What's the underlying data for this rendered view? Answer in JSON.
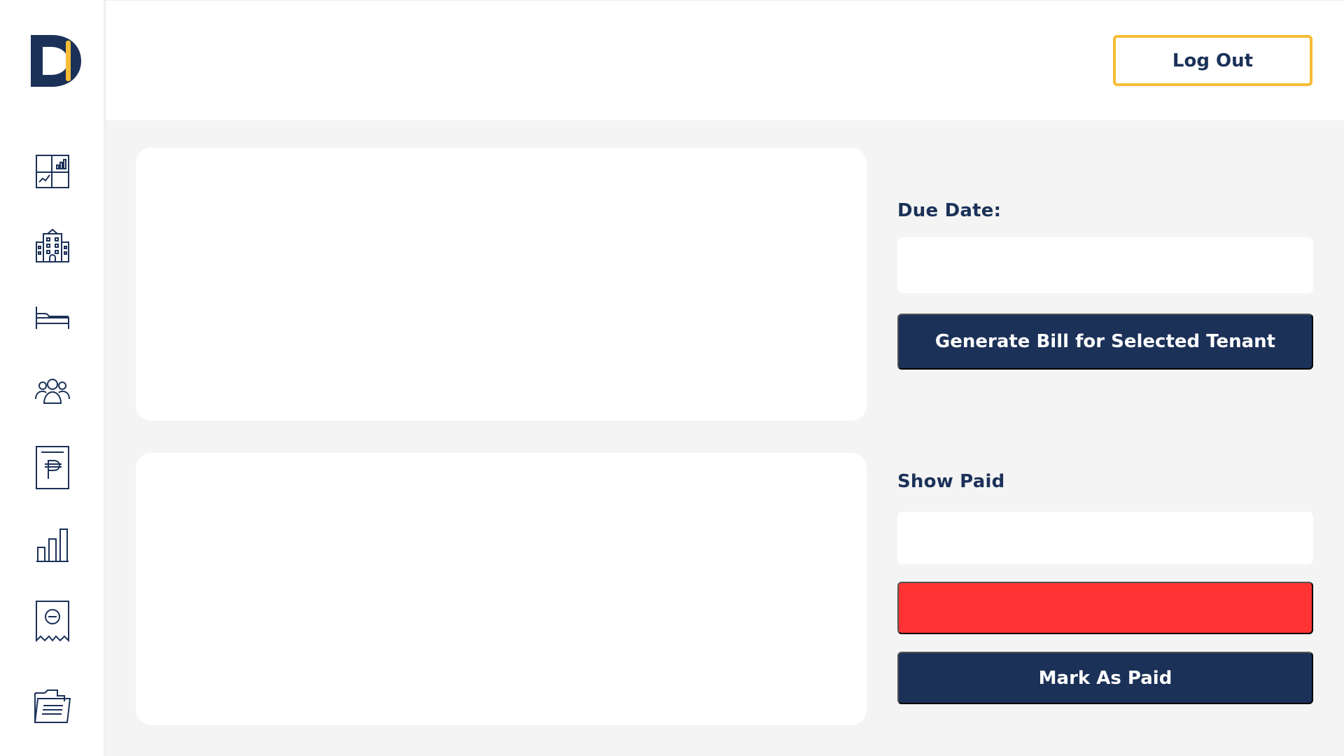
{
  "colors": {
    "navy": "#1b3158",
    "accent_yellow": "#f6bd35",
    "danger_red": "#ff3333",
    "background": "#f4f4f4"
  },
  "sidebar": {
    "logo_icon": "brand-logo-d",
    "items": [
      {
        "id": "dashboard",
        "icon": "dashboard-icon"
      },
      {
        "id": "buildings",
        "icon": "building-icon"
      },
      {
        "id": "rooms",
        "icon": "bed-icon"
      },
      {
        "id": "tenants",
        "icon": "users-icon"
      },
      {
        "id": "billing",
        "icon": "peso-bill-icon"
      },
      {
        "id": "reports",
        "icon": "bar-chart-icon"
      },
      {
        "id": "expenses",
        "icon": "receipt-minus-icon"
      },
      {
        "id": "records",
        "icon": "folder-icon"
      }
    ]
  },
  "header": {
    "logout_label": "Log Out"
  },
  "billing_form": {
    "due_date_label": "Due Date:",
    "due_date_value": "",
    "generate_label": "Generate Bill for Selected Tenant"
  },
  "payment_form": {
    "show_paid_label": "Show Paid",
    "show_paid_value": "",
    "red_button_label": "",
    "mark_paid_label": "Mark As Paid"
  }
}
